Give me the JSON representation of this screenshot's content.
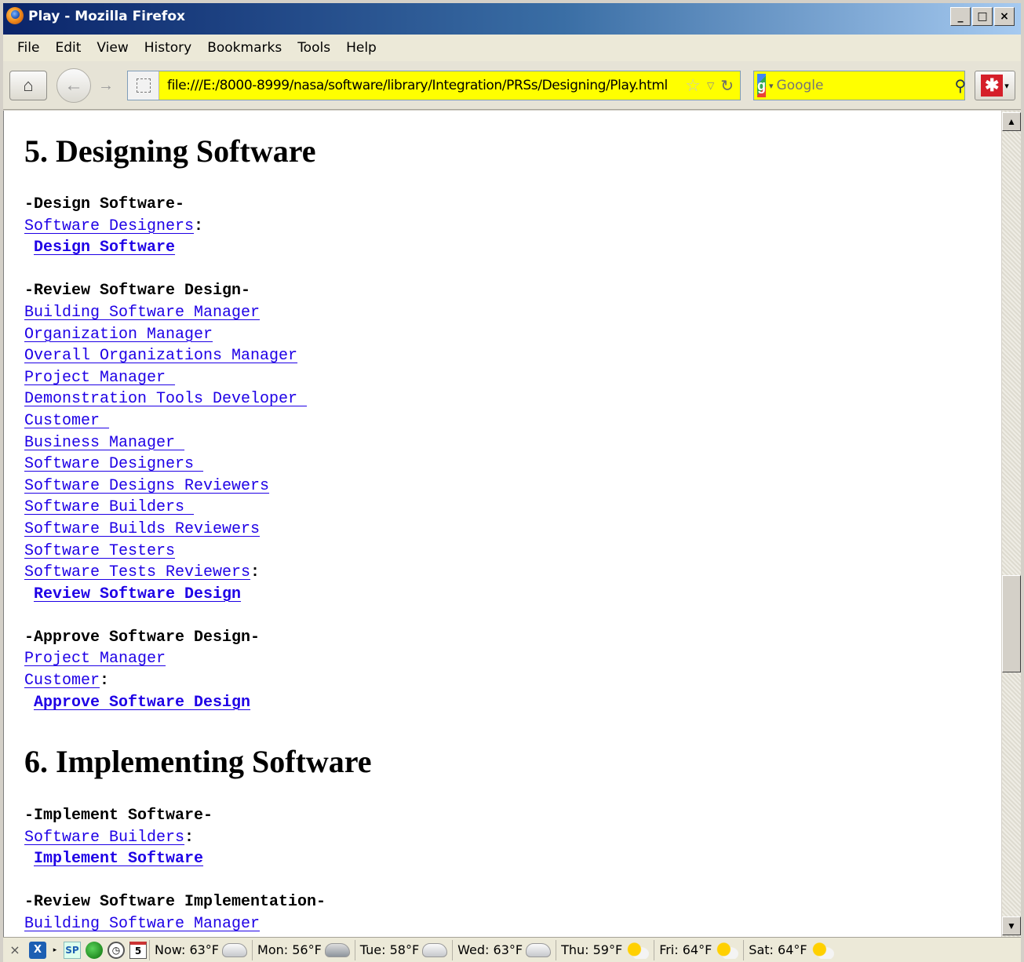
{
  "window": {
    "title": "Play - Mozilla Firefox",
    "controls": [
      "_",
      "□",
      "×"
    ]
  },
  "menu": [
    "File",
    "Edit",
    "View",
    "History",
    "Bookmarks",
    "Tools",
    "Help"
  ],
  "nav": {
    "url": "file:///E:/8000-8999/nasa/software/library/Integration/PRSs/Designing/Play.html",
    "search_placeholder": "Google",
    "url_bar_color": "#ffff00"
  },
  "page": {
    "sections": [
      {
        "heading": "5. Designing Software",
        "blocks": [
          {
            "title": "-Design Software-",
            "links": [
              "Software Designers"
            ],
            "action": "Design Software"
          },
          {
            "title": "-Review Software Design-",
            "links": [
              "Building Software Manager",
              "Organization Manager",
              "Overall Organizations Manager",
              "Project Manager ",
              "Demonstration Tools Developer ",
              "Customer ",
              "Business Manager ",
              "Software Designers ",
              "Software Designs Reviewers",
              "Software Builders ",
              "Software Builds Reviewers",
              "Software Testers",
              "Software Tests Reviewers"
            ],
            "action": "Review Software Design"
          },
          {
            "title": "-Approve Software Design-",
            "links": [
              "Project Manager",
              "Customer"
            ],
            "action": "Approve Software Design"
          }
        ]
      },
      {
        "heading": "6. Implementing Software",
        "blocks": [
          {
            "title": "-Implement Software-",
            "links": [
              "Software Builders"
            ],
            "action": "Implement Software"
          },
          {
            "title": "-Review Software Implementation-",
            "links": [
              "Building Software Manager"
            ],
            "action": ""
          }
        ]
      }
    ],
    "colon": ":",
    "link_color": "#1e00e6"
  },
  "status": {
    "close": "×",
    "calendar_day": "5",
    "sp_label": "SP",
    "weather": [
      {
        "label": "Now: 63°F",
        "icon": "cloud-icon"
      },
      {
        "label": "Mon: 56°F",
        "icon": "rain-cloud-icon"
      },
      {
        "label": "Tue: 58°F",
        "icon": "cloud-icon"
      },
      {
        "label": "Wed: 63°F",
        "icon": "cloud-icon"
      },
      {
        "label": "Thu: 59°F",
        "icon": "partly-sunny-icon"
      },
      {
        "label": "Fri: 64°F",
        "icon": "partly-sunny-icon"
      },
      {
        "label": "Sat: 64°F",
        "icon": "partly-sunny-icon"
      }
    ]
  }
}
